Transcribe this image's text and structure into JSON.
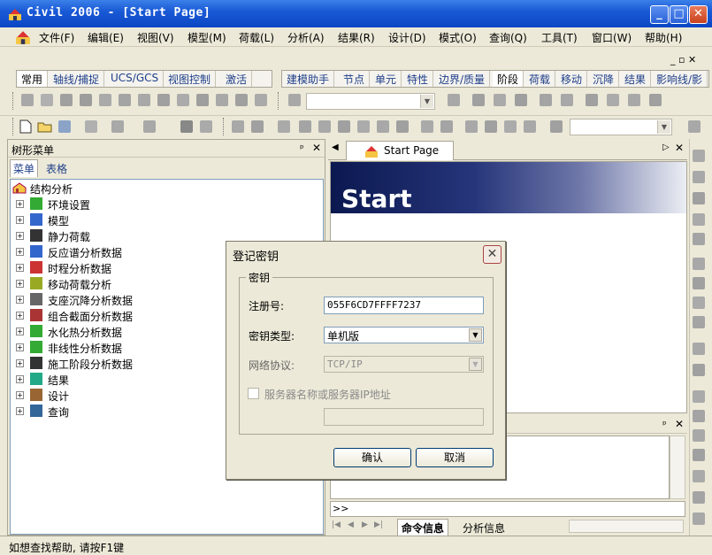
{
  "window": {
    "title": "Civil 2006 - [Start Page]",
    "min": "_",
    "max": "□",
    "close": "✕"
  },
  "menu": [
    "文件(F)",
    "编辑(E)",
    "视图(V)",
    "模型(M)",
    "荷载(L)",
    "分析(A)",
    "结果(R)",
    "设计(D)",
    "模式(O)",
    "查询(Q)",
    "工具(T)",
    "窗口(W)",
    "帮助(H)"
  ],
  "mdi_controls": "_ ▫ ✕",
  "ribbon_tabs_left": [
    "常用",
    "轴线/捕捉",
    "UCS/GCS",
    "视图控制",
    "激活"
  ],
  "ribbon_tabs_right": [
    "建模助手",
    "节点",
    "单元",
    "特性",
    "边界/质量",
    "阶段",
    "荷载",
    "移动",
    "沉降",
    "结果",
    "影响线/影"
  ],
  "active_right_tab": "阶段",
  "tree_panel": {
    "title": "树形菜单",
    "pin": "ᵖ",
    "close": "✕",
    "tabs": [
      "菜单",
      "表格"
    ],
    "root": "结构分析",
    "items": [
      "环境设置",
      "模型",
      "静力荷载",
      "反应谱分析数据",
      "时程分析数据",
      "移动荷载分析",
      "支座沉降分析数据",
      "组合截面分析数据",
      "水化热分析数据",
      "非线性分析数据",
      "施工阶段分析数据",
      "结果",
      "设计",
      "查询"
    ]
  },
  "doc": {
    "tab": "Start Page",
    "banner": "Start"
  },
  "command": {
    "prompt": ">>",
    "tabs": [
      "命令信息",
      "分析信息"
    ]
  },
  "status": "如想查找帮助, 请按F1键",
  "dialog": {
    "title": "登记密钥",
    "group": "密钥",
    "reg_label": "注册号:",
    "reg_value": "055F6CD7FFFF7237",
    "type_label": "密钥类型:",
    "type_value": "单机版",
    "proto_label": "网络协议:",
    "proto_value": "TCP/IP",
    "server_label": "服务器名称或服务器IP地址",
    "ok": "确认",
    "cancel": "取消"
  },
  "colors": {
    "titlebar": "#0a46c4",
    "face": "#ECE9D8",
    "link": "#1f3f8a"
  }
}
